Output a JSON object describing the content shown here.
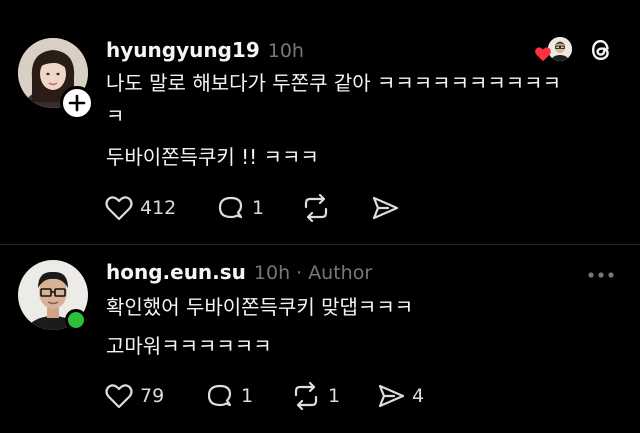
{
  "post1": {
    "username": "hyungyung19",
    "time": "10h",
    "line1": "나도 말로 해보다가 두쫀쿠 같아 ㅋㅋㅋㅋㅋㅋㅋㅋㅋㅋ",
    "line2": "ㅋ",
    "line3": "두바이쫀득쿠키 !! ㅋㅋㅋ",
    "likes": "412",
    "replies": "1",
    "reposts": "",
    "shares": ""
  },
  "post2": {
    "username": "hong.eun.su",
    "time": "10h",
    "separator": "·",
    "author_label": "Author",
    "line1": "확인했어 두바이쫀득쿠키 맞댑ㅋㅋㅋ",
    "line2": "고마워ㅋㅋㅋㅋㅋㅋ",
    "likes": "79",
    "replies": "1",
    "reposts": "1",
    "shares": "4"
  },
  "icons": {
    "like": "heart-icon",
    "reply": "comment-icon",
    "repost": "repost-icon",
    "share": "send-icon",
    "threads": "threads-logo-icon",
    "more": "more-icon",
    "add": "plus-icon"
  },
  "colors": {
    "background": "#000000",
    "text": "#f3f5f7",
    "muted": "#777777",
    "heart_red": "#ff3040",
    "online_green": "#2fbf3a"
  }
}
